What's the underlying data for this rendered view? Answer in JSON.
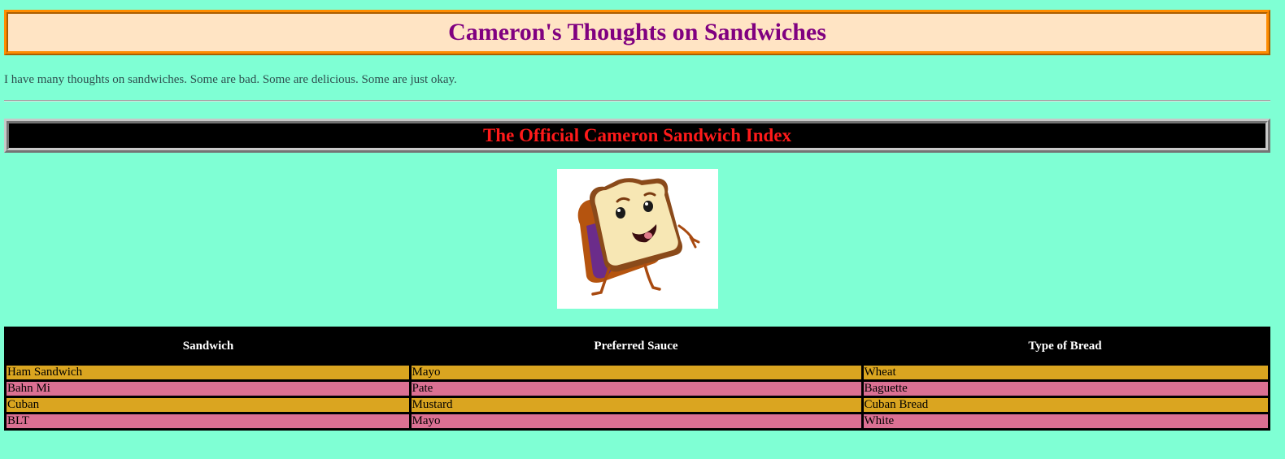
{
  "header": {
    "title": "Cameron's Thoughts on Sandwiches"
  },
  "intro": {
    "text": "I have many thoughts on sandwiches. Some are bad. Some are delicious. Some are just okay."
  },
  "index": {
    "title": "The Official Cameron Sandwich Index"
  },
  "image": {
    "icon": "cartoon-bread-slice-mascot"
  },
  "table": {
    "headers": [
      "Sandwich",
      "Preferred Sauce",
      "Type of Bread"
    ],
    "rows": [
      [
        "Ham Sandwich",
        "Mayo",
        "Wheat"
      ],
      [
        "Bahn Mi",
        "Pate",
        "Baguette"
      ],
      [
        "Cuban",
        "Mustard",
        "Cuban Bread"
      ],
      [
        "BLT",
        "Mayo",
        "White"
      ]
    ]
  },
  "colors": {
    "page_background": "#7fffd4",
    "title_color": "#800080",
    "title_background": "#ffe4c4",
    "title_border": "#ff8c00",
    "index_color": "#ff1a1a",
    "index_background": "#000000",
    "row_gold": "#daa520",
    "row_pink": "#db7093"
  }
}
